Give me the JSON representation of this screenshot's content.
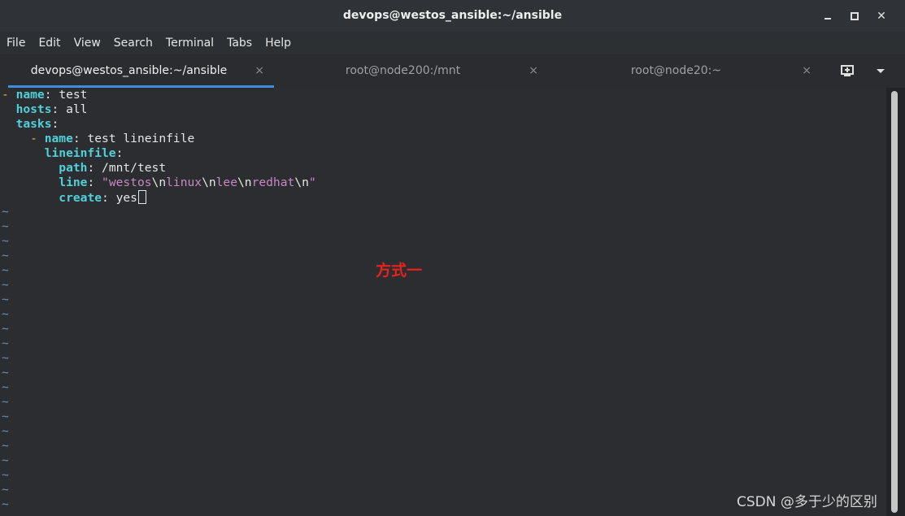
{
  "window": {
    "title": "devops@westos_ansible:~/ansible"
  },
  "menu": [
    "File",
    "Edit",
    "View",
    "Search",
    "Terminal",
    "Tabs",
    "Help"
  ],
  "tabs": [
    {
      "label": "devops@westos_ansible:~/ansible",
      "close": "×",
      "active": true
    },
    {
      "label": "root@node200:/mnt",
      "close": "×",
      "active": false
    },
    {
      "label": "root@node20:~",
      "close": "×",
      "active": false
    }
  ],
  "editor": {
    "l1": {
      "dash": "- ",
      "key": "name",
      "sep": ": ",
      "val": "test"
    },
    "l2": {
      "key": "hosts",
      "sep": ": ",
      "val": "all"
    },
    "l3": {
      "key": "tasks",
      "sep": ":"
    },
    "l4": {
      "dash": "- ",
      "key": "name",
      "sep": ": ",
      "val": "test lineinfile"
    },
    "l5": {
      "key": "lineinfile",
      "sep": ":"
    },
    "l6": {
      "key": "path",
      "sep": ": ",
      "val": "/mnt/test"
    },
    "l7": {
      "key": "line",
      "sep": ": ",
      "q1": "\"",
      "p1": "westos",
      "e1": "\\n",
      "p2": "linux",
      "e2": "\\n",
      "p3": "lee",
      "e3": "\\n",
      "p4": "redhat",
      "e4": "\\n",
      "q2": "\""
    },
    "l8": {
      "key": "create",
      "sep": ": ",
      "val": "yes"
    },
    "tilde": "~"
  },
  "annotation": "方式一",
  "watermark": "CSDN @多于少的区别",
  "colors": {
    "key": "#4fd1d9",
    "string": "#c888c2",
    "tilde": "#6a8fb0",
    "annotation": "#e8221c",
    "active_tab_underline": "#3d8ee0"
  }
}
